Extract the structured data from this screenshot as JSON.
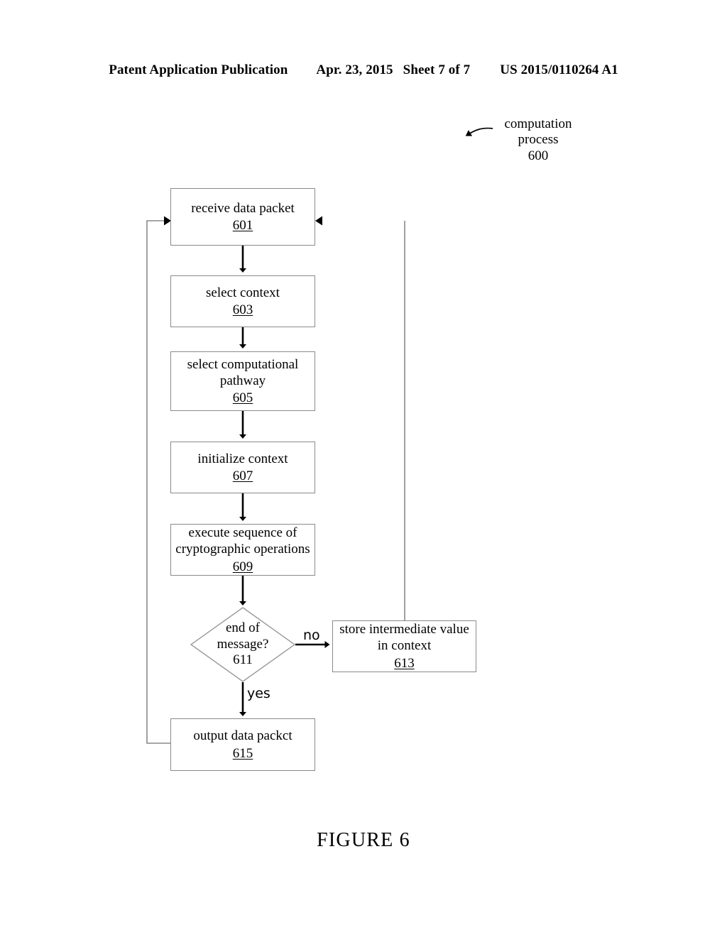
{
  "header": {
    "publication": "Patent Application Publication",
    "date": "Apr. 23, 2015",
    "sheet": "Sheet 7 of 7",
    "doc_number": "US 2015/0110264 A1"
  },
  "callout": {
    "line1": "computation",
    "line2": "process",
    "ref": "600"
  },
  "caption": "FIGURE 6",
  "edge_labels": {
    "no": "no",
    "yes": "yes"
  },
  "colors": {
    "ink": "#000000",
    "box_stroke": "#8a8a8a",
    "arrow": "#000000",
    "background": "#ffffff"
  },
  "nodes": [
    {
      "id": "601",
      "label_lines": [
        "receive data packet"
      ],
      "ref": "601",
      "shape": "rect"
    },
    {
      "id": "603",
      "label_lines": [
        "select context"
      ],
      "ref": "603",
      "shape": "rect"
    },
    {
      "id": "605",
      "label_lines": [
        "select computational",
        "pathway"
      ],
      "ref": "605",
      "shape": "rect"
    },
    {
      "id": "607",
      "label_lines": [
        "initialize context"
      ],
      "ref": "607",
      "shape": "rect"
    },
    {
      "id": "609",
      "label_lines": [
        "execute sequence of",
        "cryptographic operations"
      ],
      "ref": "609",
      "shape": "rect"
    },
    {
      "id": "611",
      "label_lines": [
        "end of",
        "message?"
      ],
      "ref": "611",
      "shape": "diamond"
    },
    {
      "id": "613",
      "label_lines": [
        "store intermediate value",
        "in context"
      ],
      "ref": "613",
      "shape": "rect"
    },
    {
      "id": "615",
      "label_lines": [
        "output data packct"
      ],
      "ref": "615",
      "shape": "rect"
    }
  ]
}
